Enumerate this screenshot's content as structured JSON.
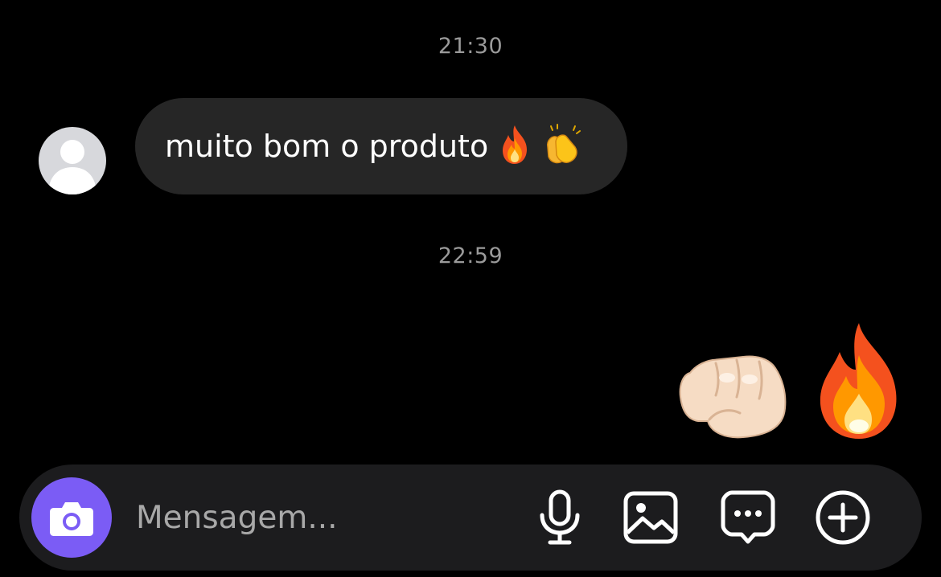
{
  "thread": {
    "timestamp_1": "21:30",
    "timestamp_2": "22:59",
    "incoming_message": {
      "text": "muito bom o produto",
      "emojis": [
        "fire-emoji",
        "clapping-hands-emoji"
      ]
    },
    "outgoing_message": {
      "emojis": [
        "oncoming-fist-emoji",
        "fire-emoji"
      ]
    }
  },
  "composer": {
    "placeholder": "Mensagem...",
    "buttons": [
      "camera-icon",
      "microphone-icon",
      "gallery-icon",
      "sticker-icon",
      "plus-icon"
    ]
  },
  "colors": {
    "background": "#000000",
    "incoming_bubble": "#262626",
    "composer_bar": "#1c1c1e",
    "camera_button": "#7b5cf5",
    "timestamp": "#9a9a9a"
  }
}
